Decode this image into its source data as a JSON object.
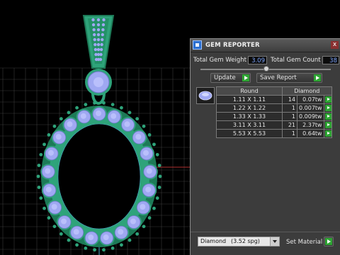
{
  "panel": {
    "title": "GEM REPORTER",
    "close_label": "x",
    "total_weight_label": "Total Gem Weight",
    "total_weight_value": "3.09",
    "total_count_label": "Total Gem Count",
    "total_count_value": "38",
    "update_label": "Update",
    "save_report_label": "Save Report",
    "table": {
      "headers": [
        "Round",
        "Diamond"
      ],
      "rows": [
        {
          "size": "1.11 X 1.11",
          "count": "14",
          "weight": "0.07tw"
        },
        {
          "size": "1.22 X 1.22",
          "count": "1",
          "weight": "0.007tw"
        },
        {
          "size": "1.33 X 1.33",
          "count": "1",
          "weight": "0.009tw"
        },
        {
          "size": "3.11 X 3.11",
          "count": "21",
          "weight": "2.37tw"
        },
        {
          "size": "5.53 X 5.53",
          "count": "1",
          "weight": "0.64tw"
        }
      ]
    },
    "material": {
      "selected": "Diamond",
      "density": "(3.52 spg)",
      "set_label": "Set Material"
    }
  },
  "colors": {
    "metal": "#2ea37a",
    "metal_dark": "#1d7a57",
    "gem": "#9fa8f2",
    "grid": "#4a4a4a",
    "accent_green": "#2ea533",
    "value_blue": "#7ea6ff"
  }
}
